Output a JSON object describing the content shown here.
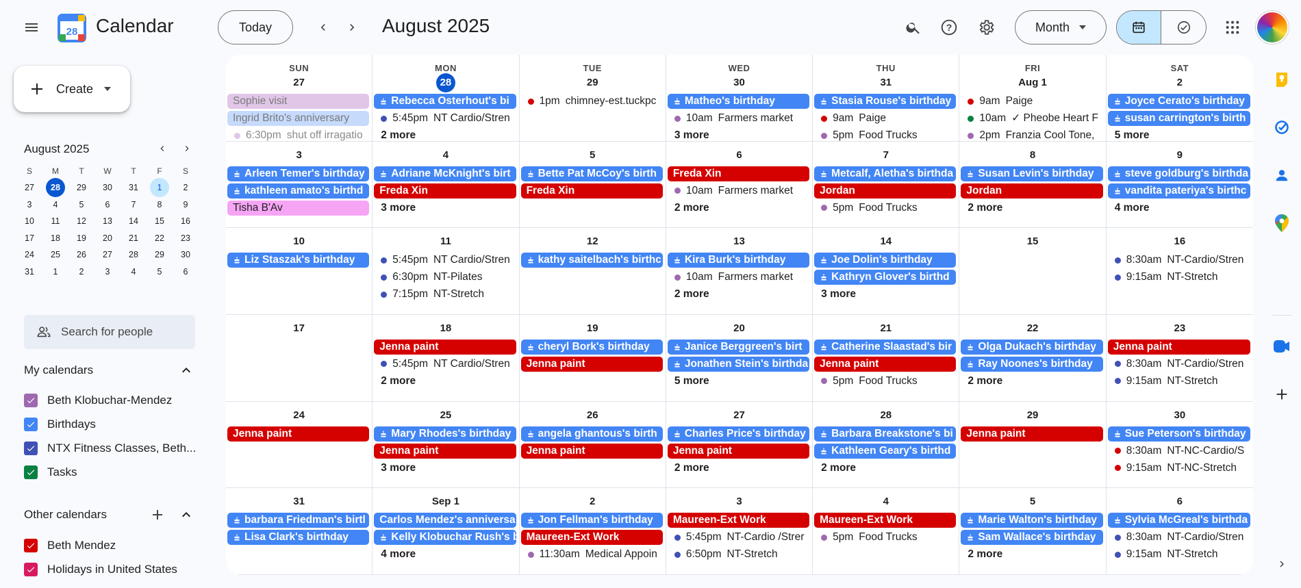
{
  "app": {
    "title": "Calendar",
    "logo_text": "28"
  },
  "toolbar": {
    "today": "Today",
    "period": "August 2025",
    "view": "Month"
  },
  "sidebar": {
    "create": "Create",
    "mini_title": "August 2025",
    "dow": [
      "S",
      "M",
      "T",
      "W",
      "T",
      "F",
      "S"
    ],
    "days": [
      "27",
      "28",
      "29",
      "30",
      "31",
      "1",
      "2",
      "3",
      "4",
      "5",
      "6",
      "7",
      "8",
      "9",
      "10",
      "11",
      "12",
      "13",
      "14",
      "15",
      "16",
      "17",
      "18",
      "19",
      "20",
      "21",
      "22",
      "23",
      "24",
      "25",
      "26",
      "27",
      "28",
      "29",
      "30",
      "31",
      "1",
      "2",
      "3",
      "4",
      "5",
      "6"
    ],
    "search_people": "Search for people",
    "my_calendars_title": "My calendars",
    "my_calendars": [
      {
        "label": "Beth Klobuchar-Mendez",
        "color": "#9e69af"
      },
      {
        "label": "Birthdays",
        "color": "#4285f4"
      },
      {
        "label": "NTX Fitness Classes, Beth...",
        "color": "#3f51b5"
      },
      {
        "label": "Tasks",
        "color": "#0b8043"
      }
    ],
    "other_calendars_title": "Other calendars",
    "other_calendars": [
      {
        "label": "Beth Mendez",
        "color": "#d50000"
      },
      {
        "label": "Holidays in United States",
        "color": "#d81b60"
      }
    ]
  },
  "colors": {
    "red": "#d50000",
    "blue": "#4285f4",
    "pink": "#f6a5f5",
    "purple": "#9e69af",
    "navy": "#3f51b5",
    "green": "#0b8043"
  },
  "month": {
    "dow": [
      "SUN",
      "MON",
      "TUE",
      "WED",
      "THU",
      "FRI",
      "SAT"
    ],
    "weeks": [
      [
        {
          "day": "27",
          "events": [
            {
              "k": "chip",
              "c": "#e1c6e7",
              "fg": "#7a7a7a",
              "text": "Sophie visit"
            },
            {
              "k": "chip",
              "c": "#c6dafc",
              "fg": "#7a7a7a",
              "text": "Ingrid Brito's anniversary"
            },
            {
              "k": "dot",
              "c": "#e1c6e7",
              "time": "6:30pm",
              "text": "shut off irragatio",
              "faded": true
            }
          ]
        },
        {
          "day": "28",
          "today": true,
          "events": [
            {
              "k": "chip",
              "c": "#4285f4",
              "cake": true,
              "text": "Rebecca Osterhout's bi"
            },
            {
              "k": "dot",
              "c": "#3f51b5",
              "time": "5:45pm",
              "text": "NT Cardio/Stren"
            }
          ],
          "more": "2 more"
        },
        {
          "day": "29",
          "events": [
            {
              "k": "dot",
              "c": "#d50000",
              "time": "1pm",
              "text": "chimney-est.tuckpc"
            }
          ]
        },
        {
          "day": "30",
          "events": [
            {
              "k": "chip",
              "c": "#4285f4",
              "cake": true,
              "text": "Matheo's birthday"
            },
            {
              "k": "dot",
              "c": "#9e69af",
              "time": "10am",
              "text": "Farmers market"
            }
          ],
          "more": "3 more"
        },
        {
          "day": "31",
          "events": [
            {
              "k": "chip",
              "c": "#4285f4",
              "cake": true,
              "text": "Stasia Rouse's birthday"
            },
            {
              "k": "dot",
              "c": "#d50000",
              "time": "9am",
              "text": "Paige"
            },
            {
              "k": "dot",
              "c": "#9e69af",
              "time": "5pm",
              "text": "Food Trucks"
            }
          ]
        },
        {
          "day": "Aug 1",
          "events": [
            {
              "k": "dot",
              "c": "#d50000",
              "time": "9am",
              "text": "Paige"
            },
            {
              "k": "dot",
              "c": "#0b8043",
              "time": "10am",
              "text": "✓ Pheobe Heart F"
            },
            {
              "k": "dot",
              "c": "#9e69af",
              "time": "2pm",
              "text": "Franzia Cool Tone,"
            }
          ]
        },
        {
          "day": "2",
          "events": [
            {
              "k": "chip",
              "c": "#4285f4",
              "cake": true,
              "text": "Joyce Cerato's birthday"
            },
            {
              "k": "chip",
              "c": "#4285f4",
              "cake": true,
              "text": "susan carrington's birth"
            }
          ],
          "more": "5 more"
        }
      ],
      [
        {
          "day": "3",
          "events": [
            {
              "k": "chip",
              "c": "#4285f4",
              "cake": true,
              "text": "Arleen Temer's birthday"
            },
            {
              "k": "chip",
              "c": "#4285f4",
              "cake": true,
              "text": "kathleen amato's birthd"
            },
            {
              "k": "chip",
              "c": "#f6a5f5",
              "fg": "#1f1f1f",
              "text": "Tisha B'Av"
            }
          ]
        },
        {
          "day": "4",
          "events": [
            {
              "k": "chip",
              "c": "#4285f4",
              "cake": true,
              "text": "Adriane McKnight's birt"
            },
            {
              "k": "chip",
              "c": "#d50000",
              "text": "Freda Xin"
            }
          ],
          "more": "3 more"
        },
        {
          "day": "5",
          "events": [
            {
              "k": "chip",
              "c": "#4285f4",
              "cake": true,
              "text": "Bette Pat McCoy's birth"
            },
            {
              "k": "chip",
              "c": "#d50000",
              "text": "Freda Xin"
            }
          ]
        },
        {
          "day": "6",
          "events": [
            {
              "k": "chip",
              "c": "#d50000",
              "text": "Freda Xin"
            },
            {
              "k": "dot",
              "c": "#9e69af",
              "time": "10am",
              "text": "Farmers market"
            }
          ],
          "more": "2 more"
        },
        {
          "day": "7",
          "events": [
            {
              "k": "chip",
              "c": "#4285f4",
              "cake": true,
              "text": "Metcalf, Aletha's birthda"
            },
            {
              "k": "chip",
              "c": "#d50000",
              "text": "Jordan"
            },
            {
              "k": "dot",
              "c": "#9e69af",
              "time": "5pm",
              "text": "Food Trucks"
            }
          ]
        },
        {
          "day": "8",
          "events": [
            {
              "k": "chip",
              "c": "#4285f4",
              "cake": true,
              "text": "Susan Levin's birthday"
            },
            {
              "k": "chip",
              "c": "#d50000",
              "text": "Jordan"
            }
          ],
          "more": "2 more"
        },
        {
          "day": "9",
          "events": [
            {
              "k": "chip",
              "c": "#4285f4",
              "cake": true,
              "text": "steve goldburg's birthda"
            },
            {
              "k": "chip",
              "c": "#4285f4",
              "cake": true,
              "text": "vandita pateriya's birthc"
            }
          ],
          "more": "4 more"
        }
      ],
      [
        {
          "day": "10",
          "events": [
            {
              "k": "chip",
              "c": "#4285f4",
              "cake": true,
              "text": "Liz Staszak's birthday"
            }
          ]
        },
        {
          "day": "11",
          "events": [
            {
              "k": "dot",
              "c": "#3f51b5",
              "time": "5:45pm",
              "text": "NT Cardio/Stren"
            },
            {
              "k": "dot",
              "c": "#3f51b5",
              "time": "6:30pm",
              "text": "NT-Pilates"
            },
            {
              "k": "dot",
              "c": "#3f51b5",
              "time": "7:15pm",
              "text": "NT-Stretch"
            }
          ]
        },
        {
          "day": "12",
          "events": [
            {
              "k": "chip",
              "c": "#4285f4",
              "cake": true,
              "text": "kathy saitelbach's birthc"
            }
          ]
        },
        {
          "day": "13",
          "events": [
            {
              "k": "chip",
              "c": "#4285f4",
              "cake": true,
              "text": "Kira Burk's birthday"
            },
            {
              "k": "dot",
              "c": "#9e69af",
              "time": "10am",
              "text": "Farmers market"
            }
          ],
          "more": "2 more"
        },
        {
          "day": "14",
          "events": [
            {
              "k": "chip",
              "c": "#4285f4",
              "cake": true,
              "text": "Joe Dolin's birthday"
            },
            {
              "k": "chip",
              "c": "#4285f4",
              "cake": true,
              "text": "Kathryn Glover's birthd"
            }
          ],
          "more": "3 more"
        },
        {
          "day": "15",
          "events": []
        },
        {
          "day": "16",
          "events": [
            {
              "k": "dot",
              "c": "#3f51b5",
              "time": "8:30am",
              "text": "NT-Cardio/Stren"
            },
            {
              "k": "dot",
              "c": "#3f51b5",
              "time": "9:15am",
              "text": "NT-Stretch"
            }
          ]
        }
      ],
      [
        {
          "day": "17",
          "events": []
        },
        {
          "day": "18",
          "events": [
            {
              "k": "chip",
              "c": "#d50000",
              "text": "Jenna paint"
            },
            {
              "k": "dot",
              "c": "#3f51b5",
              "time": "5:45pm",
              "text": "NT Cardio/Stren"
            }
          ],
          "more": "2 more"
        },
        {
          "day": "19",
          "events": [
            {
              "k": "chip",
              "c": "#4285f4",
              "cake": true,
              "text": "cheryl Bork's birthday"
            },
            {
              "k": "chip",
              "c": "#d50000",
              "text": "Jenna paint"
            }
          ]
        },
        {
          "day": "20",
          "events": [
            {
              "k": "chip",
              "c": "#4285f4",
              "cake": true,
              "text": "Janice Berggreen's birt"
            },
            {
              "k": "chip",
              "c": "#4285f4",
              "cake": true,
              "text": "Jonathen Stein's birthda"
            }
          ],
          "more": "5 more"
        },
        {
          "day": "21",
          "events": [
            {
              "k": "chip",
              "c": "#4285f4",
              "cake": true,
              "text": "Catherine Slaastad's bir"
            },
            {
              "k": "chip",
              "c": "#d50000",
              "text": "Jenna paint"
            },
            {
              "k": "dot",
              "c": "#9e69af",
              "time": "5pm",
              "text": "Food Trucks"
            }
          ]
        },
        {
          "day": "22",
          "events": [
            {
              "k": "chip",
              "c": "#4285f4",
              "cake": true,
              "text": "Olga Dukach's birthday"
            },
            {
              "k": "chip",
              "c": "#4285f4",
              "cake": true,
              "text": "Ray Noones's birthday"
            }
          ],
          "more": "2 more"
        },
        {
          "day": "23",
          "events": [
            {
              "k": "chip",
              "c": "#d50000",
              "text": "Jenna paint"
            },
            {
              "k": "dot",
              "c": "#3f51b5",
              "time": "8:30am",
              "text": "NT-Cardio/Stren"
            },
            {
              "k": "dot",
              "c": "#3f51b5",
              "time": "9:15am",
              "text": "NT-Stretch"
            }
          ]
        }
      ],
      [
        {
          "day": "24",
          "events": [
            {
              "k": "chip",
              "c": "#d50000",
              "text": "Jenna paint"
            }
          ]
        },
        {
          "day": "25",
          "events": [
            {
              "k": "chip",
              "c": "#4285f4",
              "cake": true,
              "text": "Mary Rhodes's birthday"
            },
            {
              "k": "chip",
              "c": "#d50000",
              "text": "Jenna paint"
            }
          ],
          "more": "3 more"
        },
        {
          "day": "26",
          "events": [
            {
              "k": "chip",
              "c": "#4285f4",
              "cake": true,
              "text": "angela ghantous's birth"
            },
            {
              "k": "chip",
              "c": "#d50000",
              "text": "Jenna paint"
            }
          ]
        },
        {
          "day": "27",
          "events": [
            {
              "k": "chip",
              "c": "#4285f4",
              "cake": true,
              "text": "Charles Price's birthday"
            },
            {
              "k": "chip",
              "c": "#d50000",
              "text": "Jenna paint"
            }
          ],
          "more": "2 more"
        },
        {
          "day": "28",
          "events": [
            {
              "k": "chip",
              "c": "#4285f4",
              "cake": true,
              "text": "Barbara Breakstone's bi"
            },
            {
              "k": "chip",
              "c": "#4285f4",
              "cake": true,
              "text": "Kathleen Geary's birthd"
            }
          ],
          "more": "2 more"
        },
        {
          "day": "29",
          "events": [
            {
              "k": "chip",
              "c": "#d50000",
              "text": "Jenna paint"
            }
          ]
        },
        {
          "day": "30",
          "events": [
            {
              "k": "chip",
              "c": "#4285f4",
              "cake": true,
              "text": "Sue Peterson's birthday"
            },
            {
              "k": "dot",
              "c": "#d50000",
              "time": "8:30am",
              "text": "NT-NC-Cardio/S"
            },
            {
              "k": "dot",
              "c": "#d50000",
              "time": "9:15am",
              "text": "NT-NC-Stretch"
            }
          ]
        }
      ],
      [
        {
          "day": "31",
          "events": [
            {
              "k": "chip",
              "c": "#4285f4",
              "cake": true,
              "text": "barbara Friedman's birtl"
            },
            {
              "k": "chip",
              "c": "#4285f4",
              "cake": true,
              "text": "Lisa Clark's birthday"
            }
          ]
        },
        {
          "day": "Sep 1",
          "events": [
            {
              "k": "chip",
              "c": "#4285f4",
              "text": "Carlos Mendez's anniversa"
            },
            {
              "k": "chip",
              "c": "#4285f4",
              "cake": true,
              "text": "Kelly Klobuchar Rush's b"
            }
          ],
          "more": "4 more"
        },
        {
          "day": "2",
          "events": [
            {
              "k": "chip",
              "c": "#4285f4",
              "cake": true,
              "text": "Jon Fellman's birthday"
            },
            {
              "k": "chip",
              "c": "#d50000",
              "text": "Maureen-Ext Work"
            },
            {
              "k": "dot",
              "c": "#9e69af",
              "time": "11:30am",
              "text": "Medical Appoin"
            }
          ]
        },
        {
          "day": "3",
          "events": [
            {
              "k": "chip",
              "c": "#d50000",
              "text": "Maureen-Ext Work"
            },
            {
              "k": "dot",
              "c": "#3f51b5",
              "time": "5:45pm",
              "text": "NT-Cardio /Strer"
            },
            {
              "k": "dot",
              "c": "#3f51b5",
              "time": "6:50pm",
              "text": "NT-Stretch"
            }
          ]
        },
        {
          "day": "4",
          "events": [
            {
              "k": "chip",
              "c": "#d50000",
              "text": "Maureen-Ext Work"
            },
            {
              "k": "dot",
              "c": "#9e69af",
              "time": "5pm",
              "text": "Food Trucks"
            }
          ]
        },
        {
          "day": "5",
          "events": [
            {
              "k": "chip",
              "c": "#4285f4",
              "cake": true,
              "text": "Marie Walton's birthday"
            },
            {
              "k": "chip",
              "c": "#4285f4",
              "cake": true,
              "text": "Sam Wallace's birthday"
            }
          ],
          "more": "2 more"
        },
        {
          "day": "6",
          "events": [
            {
              "k": "chip",
              "c": "#4285f4",
              "cake": true,
              "text": "Sylvia McGreal's birthda"
            },
            {
              "k": "dot",
              "c": "#3f51b5",
              "time": "8:30am",
              "text": "NT-Cardio/Stren"
            },
            {
              "k": "dot",
              "c": "#3f51b5",
              "time": "9:15am",
              "text": "NT-Stretch"
            }
          ]
        }
      ]
    ]
  },
  "icons": {
    "menu": "menu-icon",
    "search": "search-icon",
    "help": "help-icon",
    "settings": "gear-icon",
    "apps": "apps-grid-icon",
    "calendar": "calendar-icon",
    "tasks": "check-circle-icon"
  }
}
